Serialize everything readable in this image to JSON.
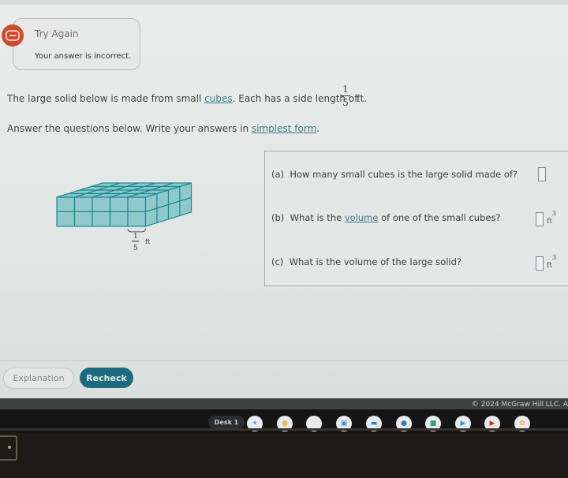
{
  "alert": {
    "title": "Try Again",
    "message": "Your answer is incorrect.",
    "icon": "chat-bubble-icon",
    "color": "#d0492c"
  },
  "problem": {
    "intro_before": "The large solid below is made from small ",
    "intro_link": "cubes",
    "intro_after": ". Each has a side length of",
    "side_numerator": "1",
    "side_denominator": "5",
    "side_unit": "ft.",
    "instruction_before": "Answer the questions below. Write your answers in ",
    "instruction_link": "simplest form",
    "instruction_after": "."
  },
  "figure": {
    "cubes_wide": 5,
    "cubes_tall": 2,
    "cubes_deep": 4,
    "label_numerator": "1",
    "label_denominator": "5",
    "label_unit": "ft",
    "fill_color": "#8fc9cc",
    "line_color": "#1f8a93"
  },
  "questions": [
    {
      "label": "(a)",
      "text_before": "How many small cubes is the large solid made of?",
      "link": "",
      "text_after": "",
      "value": "",
      "unit": ""
    },
    {
      "label": "(b)",
      "text_before": "What is the ",
      "link": "volume",
      "text_after": " of one of the small cubes?",
      "value": "",
      "unit": "ft",
      "exponent": "3"
    },
    {
      "label": "(c)",
      "text_before": "What is the volume of the large solid?",
      "link": "",
      "text_after": "",
      "value": "",
      "unit": "ft",
      "exponent": "3"
    }
  ],
  "buttons": {
    "explanation": "Explanation",
    "recheck": "Recheck",
    "recheck_color": "#1d6a7c"
  },
  "footer": {
    "copyright": "© 2024 McGraw Hill LLC. A"
  },
  "taskbar": {
    "desk_label": "Desk 1",
    "apps": [
      {
        "name": "launcher-icon",
        "color": "#5b8fd6",
        "glyph": "✦"
      },
      {
        "name": "chrome-icon",
        "color": "#e9b949",
        "glyph": "●"
      },
      {
        "name": "gmail-icon",
        "color": "#e6e6e6",
        "glyph": "M"
      },
      {
        "name": "calendar-icon",
        "color": "#4f86d8",
        "glyph": "▣"
      },
      {
        "name": "files-icon",
        "color": "#2b7fc0",
        "glyph": "▬"
      },
      {
        "name": "messages-icon",
        "color": "#2f74c9",
        "glyph": "●"
      },
      {
        "name": "meet-icon",
        "color": "#3aa36b",
        "glyph": "■"
      },
      {
        "name": "play-store-icon",
        "color": "#2a9bd6",
        "glyph": "▶"
      },
      {
        "name": "youtube-icon",
        "color": "#d2302b",
        "glyph": "▶"
      },
      {
        "name": "photos-icon",
        "color": "#e8b63a",
        "glyph": "✿"
      }
    ]
  }
}
